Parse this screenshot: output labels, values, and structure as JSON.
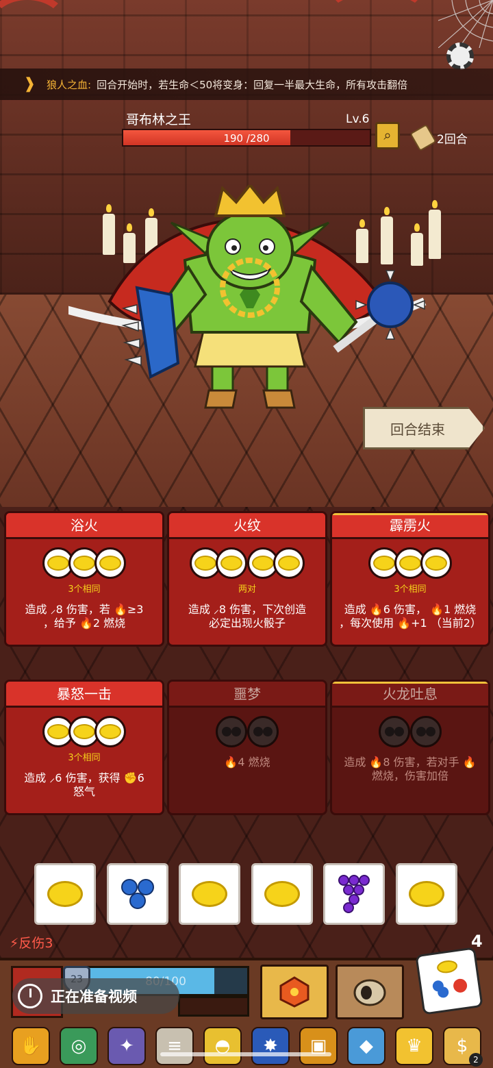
{
  "status_effect": {
    "name": "狼人之血:",
    "description": "回合开始时，若生命＜50将变身：回复一半最大生命，所有攻击翻倍",
    "icon": "fang-icon"
  },
  "enemy": {
    "name": "哥布林之王",
    "level": "Lv.6",
    "hp_text": "190 /280",
    "hp_current": 190,
    "hp_max": 280
  },
  "round": {
    "label": "2回合"
  },
  "end_turn": {
    "label": "回合结束"
  },
  "skills": [
    {
      "title": "浴火",
      "condition": "3个相同",
      "effect_line1": "造成 ⸝8 伤害，若 🔥≥3",
      "effect_line2": "，给予 🔥2 燃烧",
      "active": true
    },
    {
      "title": "火纹",
      "condition": "两对",
      "effect_line1": "造成 ⸝8 伤害，下次创造",
      "effect_line2": "必定出现火骰子",
      "active": true
    },
    {
      "title": "霹雳火",
      "condition": "3个相同",
      "effect_line1": "造成 🔥6 伤害， 🔥1 燃烧",
      "effect_line2": "，每次使用 🔥+1 （当前2）",
      "active": true
    },
    {
      "title": "暴怒一击",
      "condition": "3个相同",
      "effect_line1": "造成 ⸝6 伤害，获得 ✊6",
      "effect_line2": "怒气",
      "active": true
    },
    {
      "title": "噩梦",
      "condition": "",
      "effect_line1": "🔥4 燃烧",
      "effect_line2": "",
      "active": false
    },
    {
      "title": "火龙吐息",
      "condition": "",
      "effect_line1": "造成 🔥8 伤害，若对手 🔥",
      "effect_line2": "燃烧，伤害加倍",
      "active": false
    }
  ],
  "dice": [
    "lemon",
    "blueberry",
    "lemon",
    "lemon",
    "grape",
    "lemon"
  ],
  "player": {
    "thorns_label": "反伤3",
    "shield_value": "23",
    "mp_text": "80/100",
    "mp_current": 80,
    "mp_max": 100,
    "dice_count": "4"
  },
  "video_overlay": {
    "label": "正在准备视频"
  },
  "relics": [
    "fire-hand-icon",
    "turtle-shell-icon",
    "claw-glove-icon",
    "scroll-icon",
    "gold-helmet-icon",
    "spiked-ball-icon",
    "armor-icon",
    "ice-gem-icon",
    "crown-icon",
    "coin-bag-icon"
  ],
  "relic_badge": "2",
  "colors": {
    "accent_red": "#d9332a",
    "gold": "#f6d31a",
    "hp_red": "#f4563e",
    "mp_blue": "#5ab8e6"
  }
}
